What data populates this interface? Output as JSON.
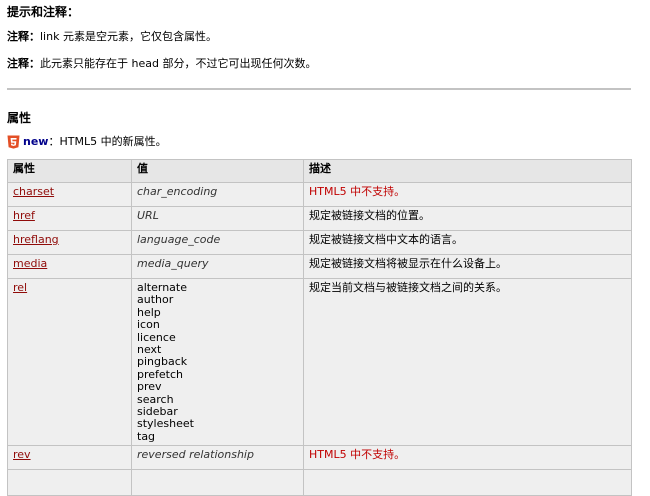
{
  "tips": {
    "title": "提示和注释：",
    "note1_label": "注释：",
    "note1_text": "link 元素是空元素，它仅包含属性。",
    "note2_label": "注释：",
    "note2_text": "此元素只能存在于 head 部分，不过它可出现任何次数。"
  },
  "attributes": {
    "title": "属性",
    "new_label": "new",
    "new_desc": "：HTML5 中的新属性。"
  },
  "table": {
    "headers": [
      "属性",
      "值",
      "描述"
    ],
    "rows": [
      {
        "attr": "charset",
        "value": "char_encoding",
        "desc": "HTML5 中不支持。",
        "red": true
      },
      {
        "attr": "href",
        "value": "URL",
        "desc": "规定被链接文档的位置。",
        "red": false
      },
      {
        "attr": "hreflang",
        "value": "language_code",
        "desc": "规定被链接文档中文本的语言。",
        "red": false
      },
      {
        "attr": "media",
        "value": "media_query",
        "desc": "规定被链接文档将被显示在什么设备上。",
        "red": false
      },
      {
        "attr": "rel",
        "values": [
          "alternate",
          "author",
          "help",
          "icon",
          "licence",
          "next",
          "pingback",
          "prefetch",
          "prev",
          "search",
          "sidebar",
          "stylesheet",
          "tag"
        ],
        "desc": "规定当前文档与被链接文档之间的关系。",
        "red": false
      },
      {
        "attr": "rev",
        "value": "reversed relationship",
        "desc": "HTML5 中不支持。",
        "red": true
      }
    ]
  },
  "colors": {
    "link": "#900b09",
    "unsupported": "#c00000",
    "html5_badge": "#e34f26"
  },
  "icons": {
    "html5": "html5-badge-icon"
  }
}
